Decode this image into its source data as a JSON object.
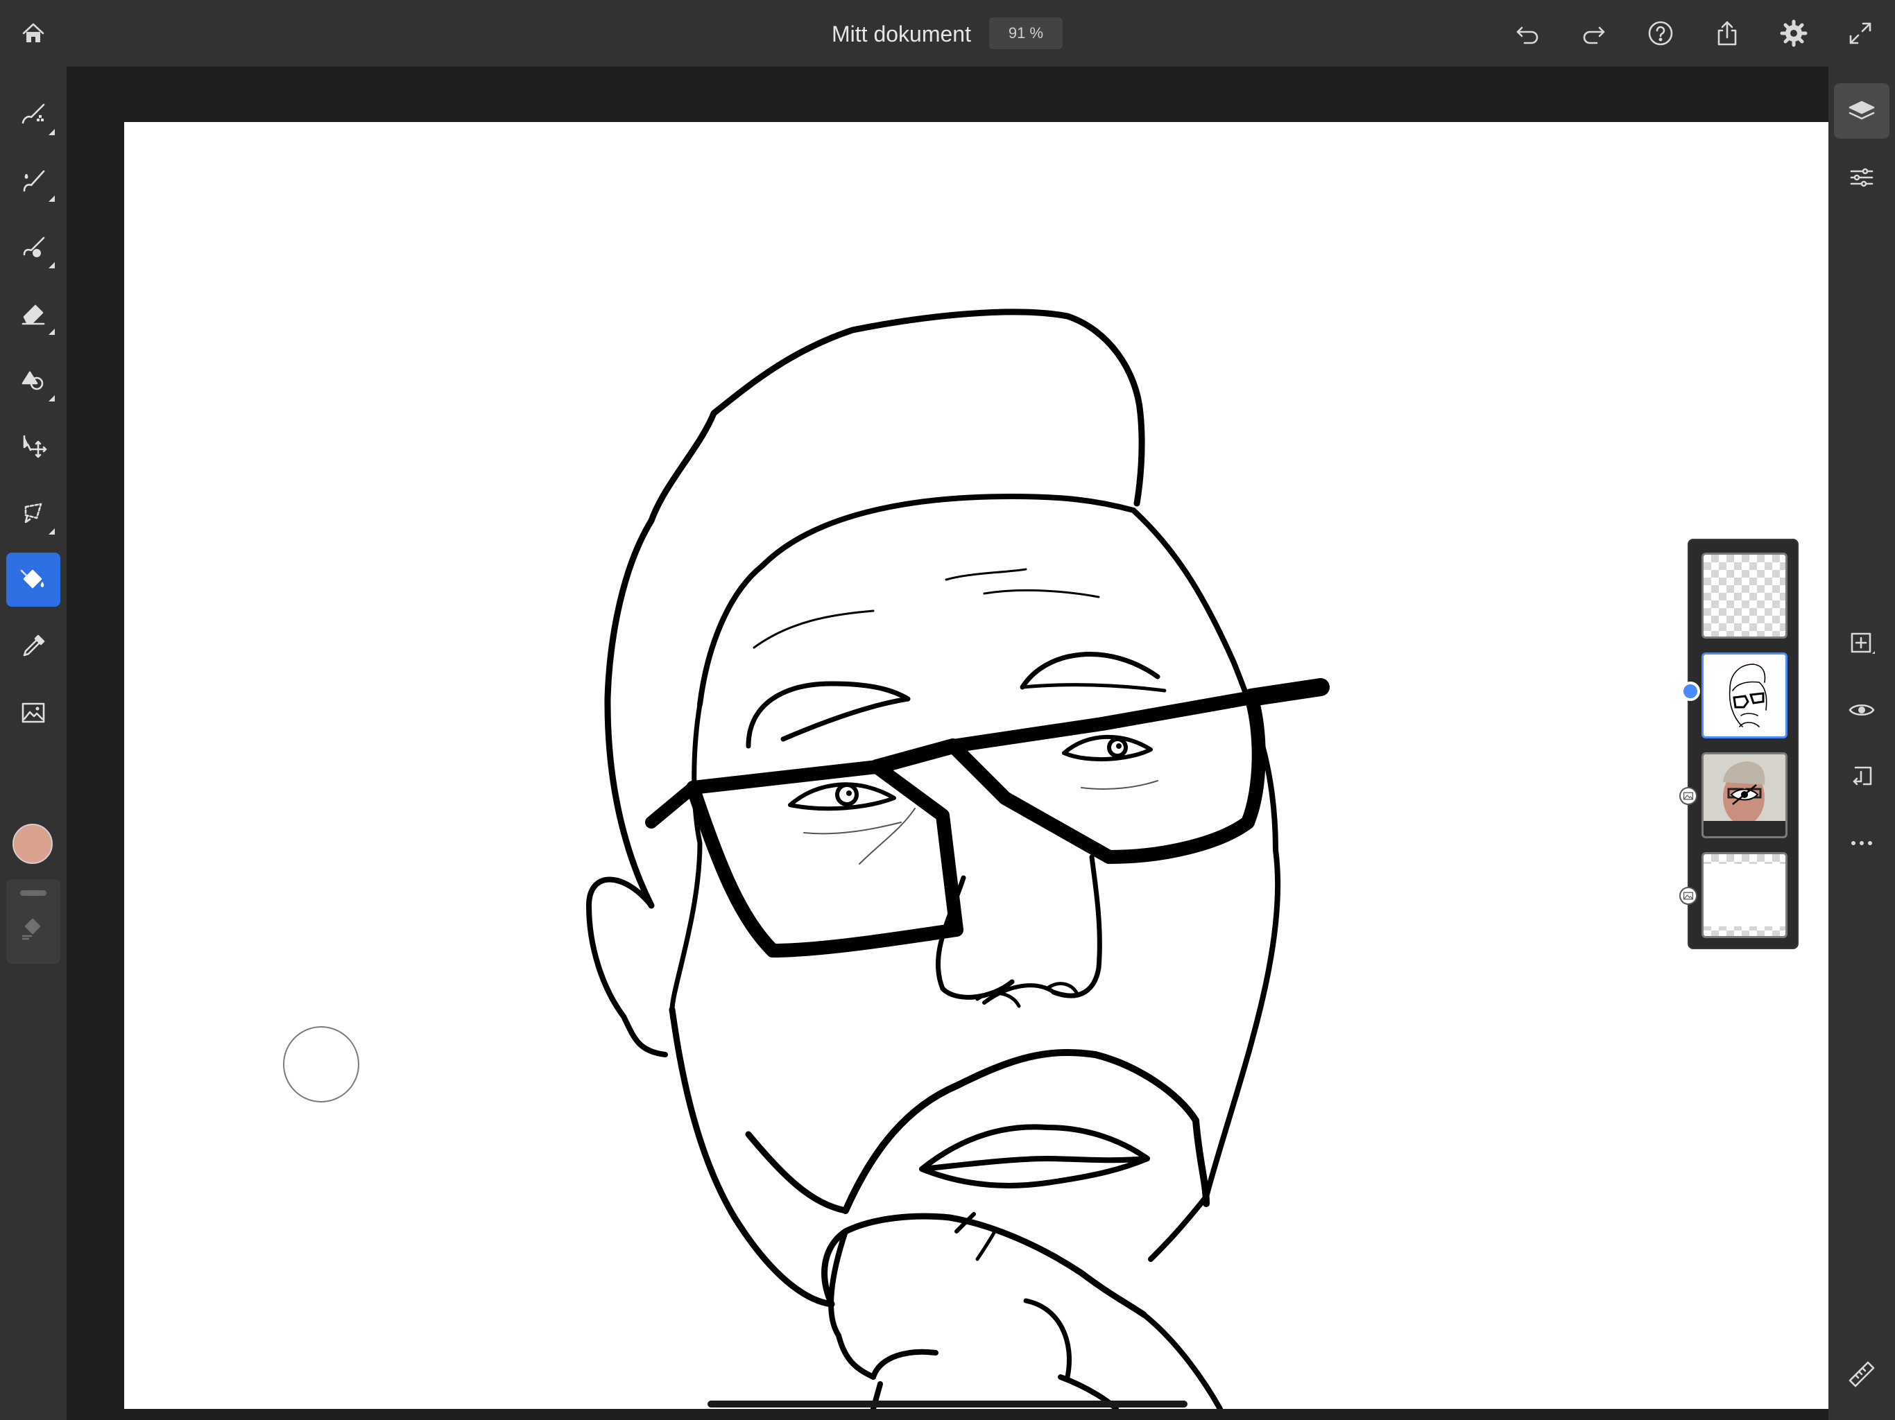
{
  "app": {
    "document_title": "Mitt dokument",
    "zoom_level": "91 %"
  },
  "top_toolbar": {
    "left": [
      "home-icon"
    ],
    "right": [
      "undo-icon",
      "redo-icon",
      "help-icon",
      "share-icon",
      "settings-icon",
      "fullscreen-icon"
    ]
  },
  "left_toolbar": {
    "tools": [
      {
        "name": "pixel-brush-tool",
        "icon": "pixel-brush-icon"
      },
      {
        "name": "live-brush-tool",
        "icon": "live-brush-icon"
      },
      {
        "name": "vector-brush-tool",
        "icon": "vector-brush-icon"
      },
      {
        "name": "eraser-tool",
        "icon": "eraser-icon"
      },
      {
        "name": "shape-tool",
        "icon": "shape-icon"
      },
      {
        "name": "transform-tool",
        "icon": "transform-icon"
      },
      {
        "name": "selection-tool",
        "icon": "lasso-icon"
      },
      {
        "name": "fill-tool",
        "icon": "paint-bucket-icon",
        "active": true
      },
      {
        "name": "eyedropper-tool",
        "icon": "eyedropper-icon"
      },
      {
        "name": "image-tool",
        "icon": "image-icon"
      }
    ],
    "current_color": "#d9a28e"
  },
  "right_toolbar": {
    "buttons": [
      "layers-icon",
      "properties-icon",
      "add-layer-icon",
      "visibility-icon",
      "merge-down-icon",
      "more-icon",
      "ruler-icon"
    ]
  },
  "layers_panel": {
    "layers": [
      {
        "type": "empty",
        "selected": false
      },
      {
        "type": "drawing",
        "selected": true
      },
      {
        "type": "photo",
        "selected": false,
        "hidden": true,
        "badge": "image-icon"
      },
      {
        "type": "background",
        "selected": false,
        "badge": "image-icon"
      }
    ]
  },
  "colors": {
    "accent": "#2f6fe4",
    "selection": "#4a8cff",
    "chrome": "#323232",
    "workspace": "#1e1e1e"
  }
}
